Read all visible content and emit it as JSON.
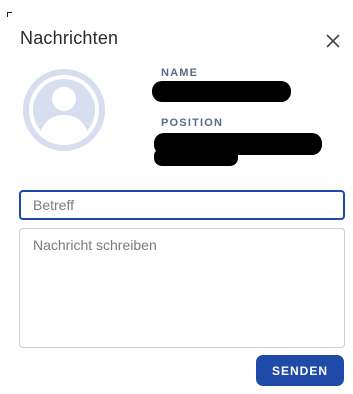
{
  "dialog": {
    "title": "Nachrichten",
    "close_icon": "close-icon"
  },
  "contact": {
    "avatar_icon": "user-avatar-icon",
    "name_label": "NAME",
    "position_label": "POSITION"
  },
  "form": {
    "subject_placeholder": "Betreff",
    "message_placeholder": "Nachricht schreiben",
    "send_label": "SENDEN"
  },
  "colors": {
    "primary": "#1f4aa8",
    "avatar_bg": "#d7def0",
    "avatar_fg": "#ffffff",
    "label": "#5a6b8a"
  }
}
